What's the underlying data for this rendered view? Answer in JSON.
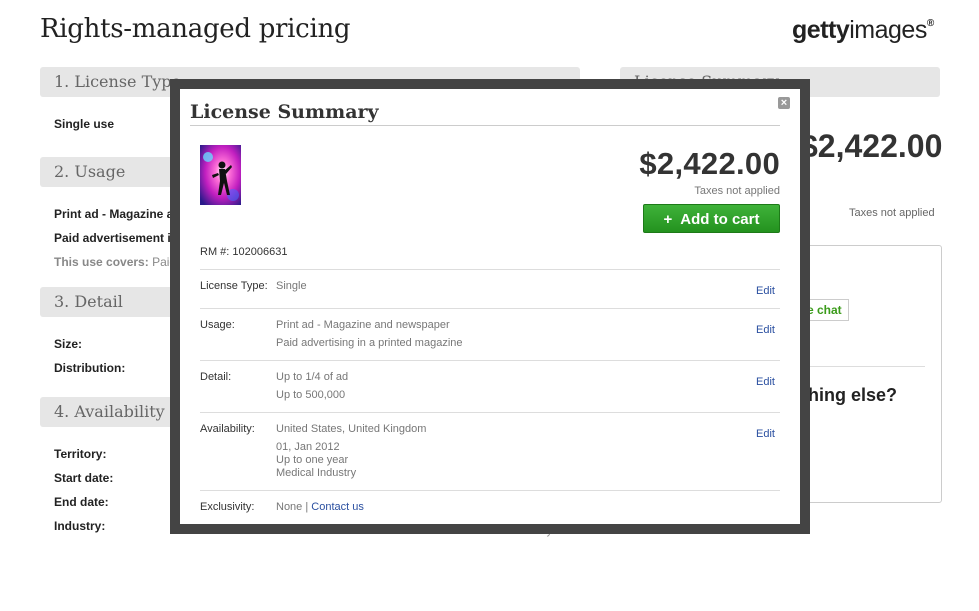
{
  "page": {
    "title": "Rights-managed pricing"
  },
  "logo": {
    "bold": "getty",
    "thin": "images",
    "mark": "®"
  },
  "background": {
    "sections": [
      {
        "label": "1. License Type"
      },
      {
        "label": "2. Usage"
      },
      {
        "label": "3. Detail"
      },
      {
        "label": "4. Availability"
      }
    ],
    "license_value": "Single use",
    "usage_line1": "Print ad - Magazine a",
    "usage_line2": "Paid advertisement i",
    "usage_covers_label": "This use covers:",
    "usage_covers_value": "Paid",
    "detail_size": "Size:",
    "detail_distribution": "Distribution:",
    "territory": "Territory:",
    "start_date": "Start date:",
    "end_date": "End date:",
    "industry": "Industry:",
    "right_title": "License Summary",
    "right_price": "$2,422.00",
    "right_taxes": "Taxes not applied",
    "chat_label": "e chat",
    "anything_else": "hing else?",
    "bottom_fragment": "Medical Industry"
  },
  "modal": {
    "title": "License Summary",
    "price": "$2,422.00",
    "taxes": "Taxes not applied",
    "add_to_cart": "Add to cart",
    "add_to_cart_icon": "+",
    "rm_number": "RM #: 102006631",
    "edit_label": "Edit",
    "license_type": {
      "label": "License Type:",
      "value": "Single"
    },
    "usage": {
      "label": "Usage:",
      "line1": "Print ad - Magazine and newspaper",
      "line2": "Paid advertising in a printed magazine"
    },
    "detail": {
      "label": "Detail:",
      "line1": "Up to 1/4 of ad",
      "line2": "Up to 500,000"
    },
    "availability": {
      "label": "Availability:",
      "line1": "United States, United Kingdom",
      "line2": "01, Jan 2012",
      "line3": "Up to one year",
      "line4": "Medical Industry"
    },
    "exclusivity": {
      "label": "Exclusivity:",
      "value": "None",
      "separator": " | ",
      "contact": "Contact us"
    }
  },
  "colors": {
    "accent_green": "#2ea629",
    "link_blue": "#2a4fa0",
    "modal_frame": "#444444"
  }
}
